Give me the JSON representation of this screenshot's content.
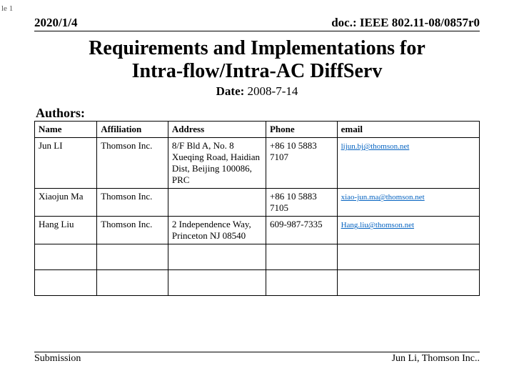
{
  "slide_label": "le 1",
  "header": {
    "date_left": "2020/1/4",
    "doc_right": "doc.: IEEE 802.11-08/0857r0"
  },
  "title_line1": "Requirements and Implementations for",
  "title_line2": "Intra-flow/Intra-AC DiffServ",
  "date": {
    "label": "Date:",
    "value": " 2008-7-14"
  },
  "authors_label": "Authors:",
  "table_headers": {
    "name": "Name",
    "affiliation": "Affiliation",
    "address": "Address",
    "phone": "Phone",
    "email": "email"
  },
  "authors": [
    {
      "name": "Jun LI",
      "affiliation": "Thomson Inc.",
      "address": "8/F Bld A, No. 8 Xueqing Road, Haidian Dist, Beijing 100086, PRC",
      "phone": "+86 10 5883 7107",
      "email": "lijun.bj@thomson.net"
    },
    {
      "name": "Xiaojun Ma",
      "affiliation": "Thomson Inc.",
      "address": "",
      "phone": "+86 10 5883 7105",
      "email": "xiao-jun.ma@thomson.net"
    },
    {
      "name": "Hang Liu",
      "affiliation": "Thomson Inc.",
      "address": "2 Independence Way, Princeton NJ 08540",
      "phone": "609-987-7335",
      "email": "Hang.liu@thomson.net"
    },
    {
      "name": "",
      "affiliation": "",
      "address": "",
      "phone": "",
      "email": ""
    },
    {
      "name": "",
      "affiliation": "",
      "address": "",
      "phone": "",
      "email": ""
    }
  ],
  "footer": {
    "left": "Submission",
    "right": "Jun Li, Thomson Inc.."
  }
}
